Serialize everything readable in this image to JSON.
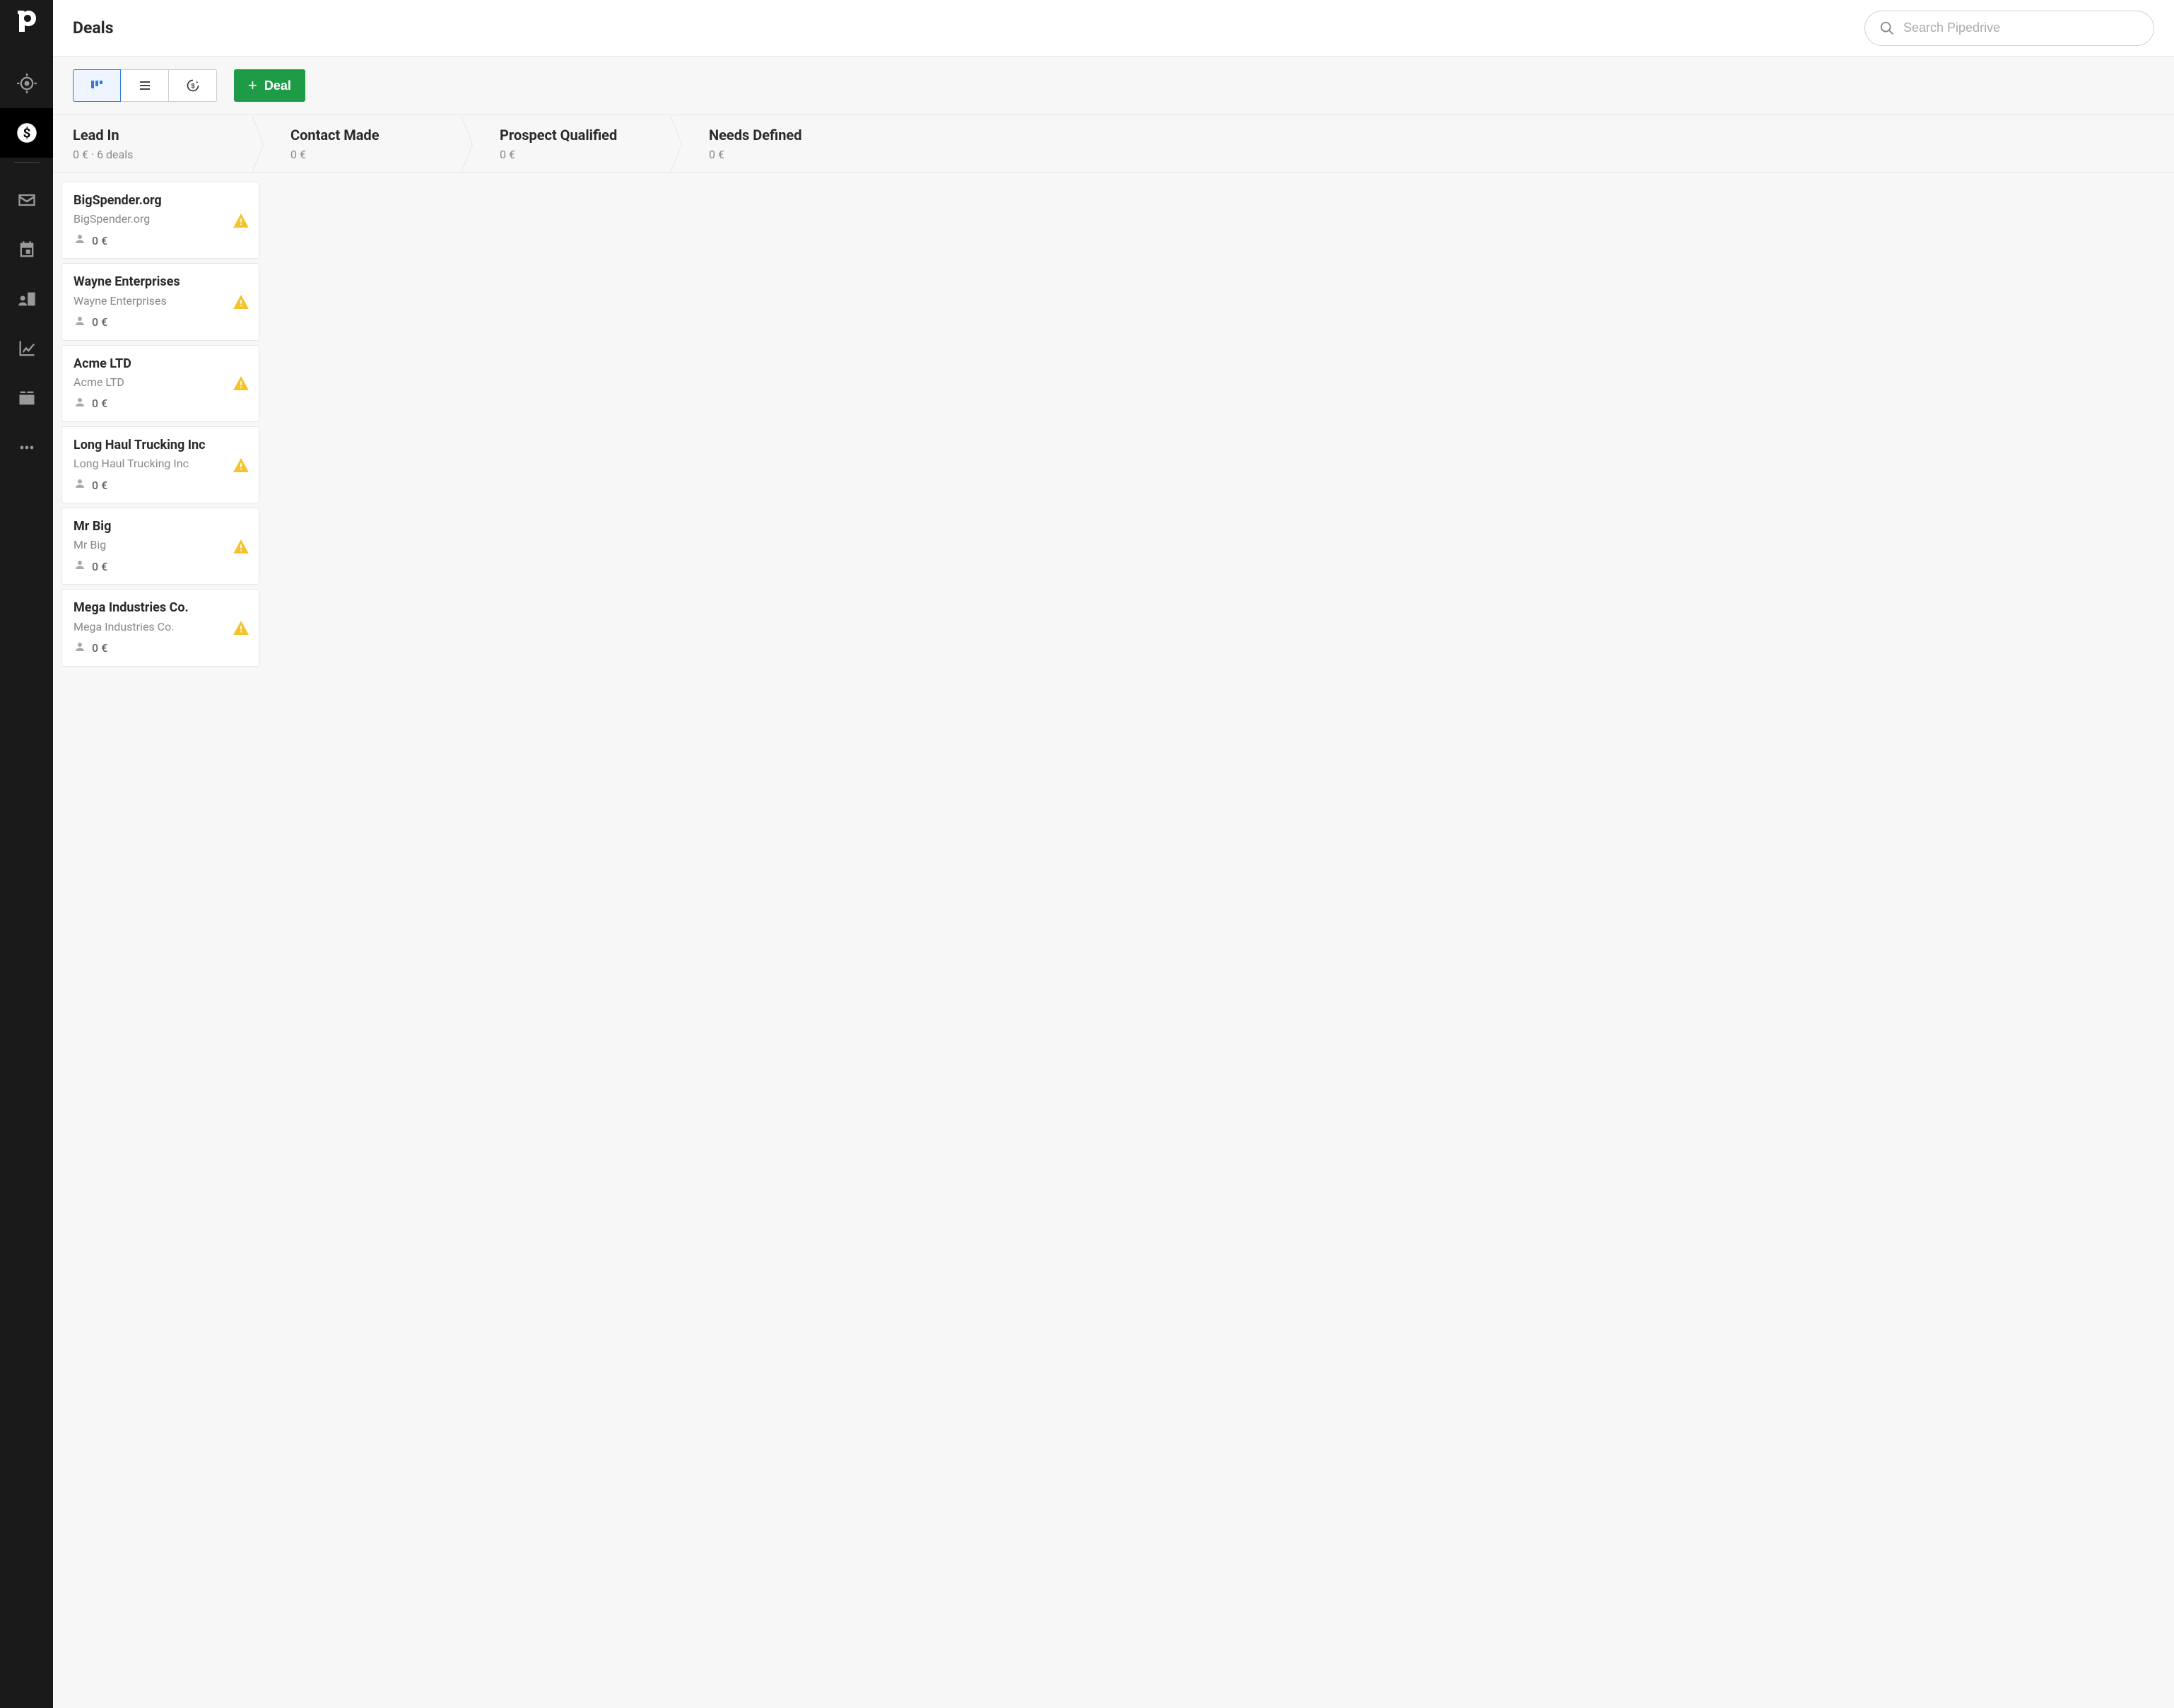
{
  "header": {
    "title": "Deals",
    "search_placeholder": "Search Pipedrive"
  },
  "toolbar": {
    "add_label": "Deal"
  },
  "stages": [
    {
      "name": "Lead In",
      "meta": "0 € · 6 deals"
    },
    {
      "name": "Contact Made",
      "meta": "0 €"
    },
    {
      "name": "Prospect Qualified",
      "meta": "0 €"
    },
    {
      "name": "Needs Defined",
      "meta": "0 €"
    }
  ],
  "columns": [
    {
      "stage": "Lead In",
      "deals": [
        {
          "title": "BigSpender.org",
          "org": "BigSpender.org",
          "value": "0 €",
          "warning": true
        },
        {
          "title": "Wayne Enterprises",
          "org": "Wayne Enterprises",
          "value": "0 €",
          "warning": true
        },
        {
          "title": "Acme LTD",
          "org": "Acme LTD",
          "value": "0 €",
          "warning": true
        },
        {
          "title": "Long Haul Trucking Inc",
          "org": "Long Haul Trucking Inc",
          "value": "0 €",
          "warning": true
        },
        {
          "title": "Mr Big",
          "org": "Mr Big",
          "value": "0 €",
          "warning": true
        },
        {
          "title": "Mega Industries Co.",
          "org": "Mega Industries Co.",
          "value": "0 €",
          "warning": true
        }
      ]
    },
    {
      "stage": "Contact Made",
      "deals": []
    },
    {
      "stage": "Prospect Qualified",
      "deals": []
    },
    {
      "stage": "Needs Defined",
      "deals": []
    }
  ]
}
